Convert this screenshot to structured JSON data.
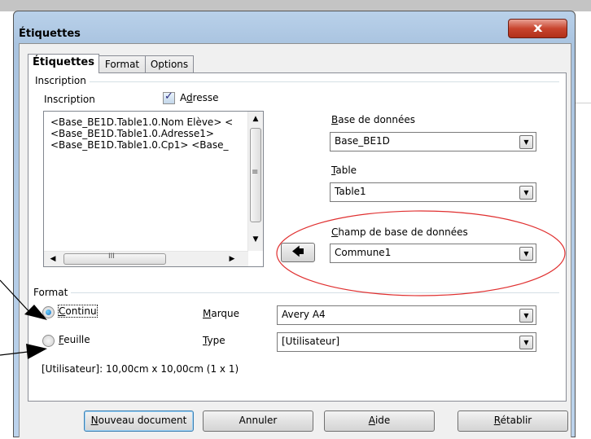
{
  "dialog": {
    "title": "Étiquettes",
    "close_glyph": "x"
  },
  "tabs": [
    {
      "label": "Étiquettes",
      "active": true
    },
    {
      "label": "Format",
      "active": false
    },
    {
      "label": "Options",
      "active": false
    }
  ],
  "inscription": {
    "group_label": "Inscription",
    "label": "Inscription",
    "address_checkbox": {
      "label_pre": "A",
      "label_u": "d",
      "label_post": "resse",
      "checked": true
    },
    "text_lines": [
      "<Base_BE1D.Table1.0.Nom Elève> <",
      "<Base_BE1D.Table1.0.Adresse1>",
      " <Base_BE1D.Table1.0.Cp1> <Base_"
    ],
    "scroll_glyphs": {
      "up": "▲",
      "down": "▼",
      "left": "◀",
      "right": "▶",
      "grip_v": "≡",
      "grip_h": "III"
    },
    "insert_arrow": "🡄"
  },
  "database": {
    "label_pre": "",
    "label_u": "B",
    "label_post": "ase de données",
    "value": "Base_BE1D"
  },
  "table": {
    "label_pre": "",
    "label_u": "T",
    "label_post": "able",
    "value": "Table1"
  },
  "field": {
    "label_pre": "",
    "label_u": "C",
    "label_post": "hamp de base de données",
    "value": "Commune1"
  },
  "format": {
    "group_label": "Format",
    "continu": {
      "label_u": "C",
      "label_post": "ontinu",
      "selected": true
    },
    "feuille": {
      "label_u": "F",
      "label_post": "euille",
      "selected": false
    },
    "marque": {
      "label_u": "M",
      "label_post": "arque",
      "value": "Avery A4"
    },
    "type": {
      "label_u": "T",
      "label_post": "ype",
      "value": "[Utilisateur]"
    },
    "size_info": "[Utilisateur]: 10,00cm x 10,00cm (1 x 1)"
  },
  "buttons": {
    "new_doc": {
      "label_u": "N",
      "label_post": "ouveau document"
    },
    "cancel": {
      "label": "Annuler"
    },
    "help": {
      "label_u": "A",
      "label_post": "ide"
    },
    "reset": {
      "label_u": "R",
      "label_post": "établir"
    }
  },
  "colors": {
    "annotation_ellipse": "#e03030",
    "title_gradient_top": "#b9d1ea",
    "close_red": "#c8452e"
  },
  "icons": {
    "dropdown": "▼",
    "dropdown_icon_name": "chevron-down-icon"
  }
}
